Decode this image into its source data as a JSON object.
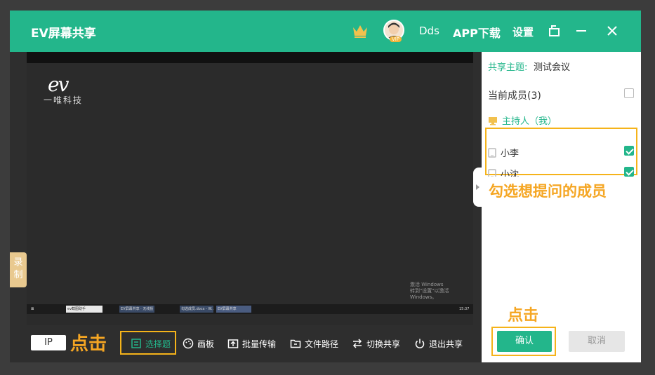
{
  "window": {
    "title": "EV屏幕共享",
    "username": "Dds",
    "vip_badge": "VIP",
    "app_download": "APP下载",
    "settings": "设置"
  },
  "screen": {
    "logo": "ev",
    "brand": "一唯科技",
    "activate_line1": "激活 Windows",
    "activate_line2": "转到\"设置\"以激活 Windows。",
    "taskbar_items": [
      "ev截图助手",
      "EV屏幕共享 · 无线投",
      "勾选成员.docx - W...",
      "EV屏幕共享"
    ],
    "clock": "15:37"
  },
  "left": {
    "record_label_1": "录",
    "record_label_2": "制"
  },
  "toolbar": {
    "ip": "IP",
    "hint_click": "点击",
    "select_question": "选择题",
    "whiteboard": "画板",
    "batch_transfer": "批量传输",
    "file_path": "文件路径",
    "switch_share": "切换共享",
    "exit_share": "退出共享"
  },
  "panel": {
    "topic_label": "共享主题:",
    "topic_value": "测试会议",
    "members_label": "当前成员(3)",
    "host": "主持人（我）",
    "members": [
      {
        "name": "小李",
        "checked": true
      },
      {
        "name": "小沈",
        "checked": true
      }
    ],
    "hint_select": "勾选想提问的成员",
    "hint_click": "点击",
    "confirm": "确认",
    "cancel": "取消"
  },
  "colors": {
    "accent": "#23b68b",
    "highlight": "#f5b31a",
    "hint_text": "#f5a623"
  }
}
